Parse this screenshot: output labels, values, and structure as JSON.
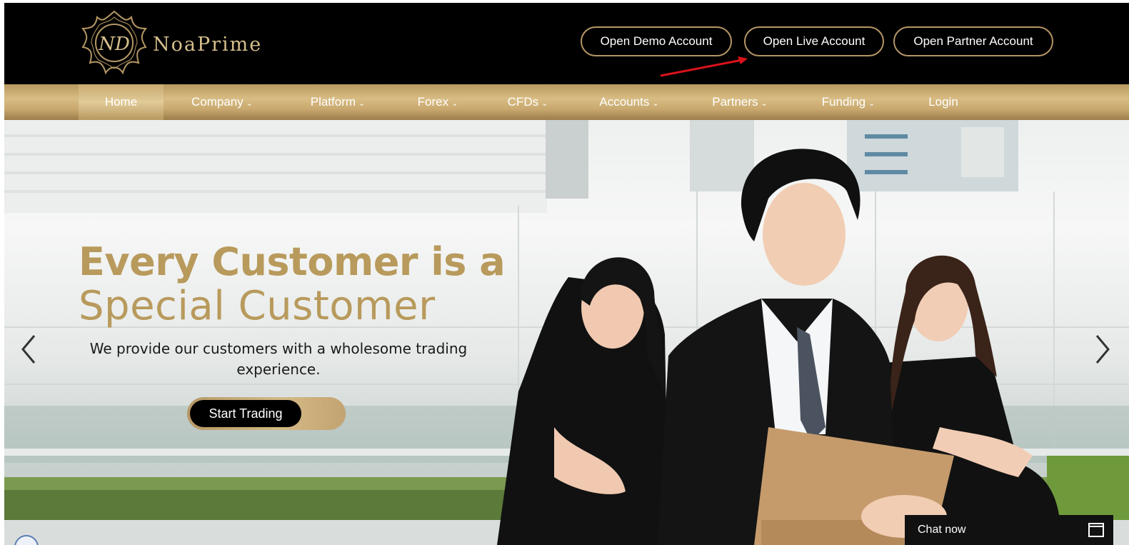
{
  "header": {
    "logo_text": "NoaPrime",
    "buttons": {
      "demo": "Open Demo Account",
      "live": "Open Live Account",
      "partner": "Open Partner Account"
    }
  },
  "nav": {
    "items": [
      {
        "label": "Home",
        "dropdown": false,
        "active": true
      },
      {
        "label": "Company",
        "dropdown": true
      },
      {
        "label": "Platform",
        "dropdown": true
      },
      {
        "label": "Forex",
        "dropdown": true
      },
      {
        "label": "CFDs",
        "dropdown": true
      },
      {
        "label": "Accounts",
        "dropdown": true
      },
      {
        "label": "Partners",
        "dropdown": true
      },
      {
        "label": "Funding",
        "dropdown": true
      },
      {
        "label": "Login",
        "dropdown": false
      }
    ],
    "chevron": "⌄"
  },
  "hero": {
    "title_line1": "Every Customer is a",
    "title_line2": "Special Customer",
    "subtitle": "We provide our customers with a wholesome trading experience.",
    "cta": "Start Trading"
  },
  "chat": {
    "label": "Chat now"
  },
  "colors": {
    "gold": "#b89a5c",
    "top_bar": "#000000",
    "annotation_arrow": "#d8131b"
  }
}
